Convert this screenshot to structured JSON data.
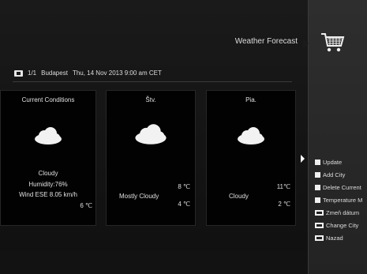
{
  "header": {
    "title": "Weather Forecast"
  },
  "info": {
    "page": "1/1",
    "city": "Budapest",
    "datetime": "Thu, 14 Nov 2013 9:00 am CET"
  },
  "cards": [
    {
      "heading": "Current Conditions",
      "condition": "Cloudy",
      "humidity": "Humidity:76%",
      "wind": "Wind ESE 8.05 km/h",
      "temp": "6 ℃"
    },
    {
      "heading": "Štv.",
      "high": "8 ℃",
      "condition": "Mostly Cloudy",
      "low": "4 ℃"
    },
    {
      "heading": "Pia.",
      "high": "11℃",
      "condition": "Cloudy",
      "low": "2 ℃"
    }
  ],
  "menu": {
    "items": [
      {
        "label": "Update",
        "icon": "white-square-button"
      },
      {
        "label": "Add City",
        "icon": "white-square-button"
      },
      {
        "label": "Delete Current",
        "icon": "white-square-button"
      },
      {
        "label": "Temperature M",
        "icon": "white-square-button"
      },
      {
        "label": "Zmeň dátum",
        "icon": "remote-key"
      },
      {
        "label": "Change City",
        "icon": "remote-key"
      },
      {
        "label": "Nazad",
        "icon": "remote-key"
      }
    ]
  },
  "colors": {
    "background": "#141414",
    "card": "#020202",
    "side": "#2a2a2a",
    "text": "#e0e0e0"
  }
}
